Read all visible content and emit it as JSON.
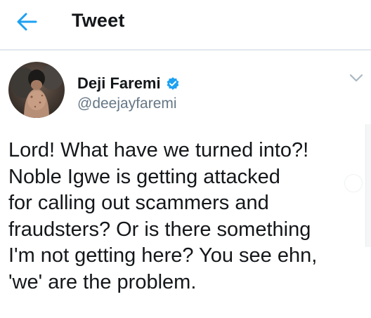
{
  "header": {
    "title": "Tweet",
    "back_icon": "arrow-left-icon",
    "accent_color": "#1da1f2"
  },
  "tweet": {
    "author": {
      "name": "Deji Faremi",
      "handle": "@deejayfaremi",
      "verified": true,
      "verified_icon": "verified-badge-icon",
      "verified_color": "#1da1f2"
    },
    "menu_icon": "chevron-down-icon",
    "text_lines": [
      "Lord! What have we turned into?!",
      "Noble Igwe is getting attacked",
      "for calling out scammers and",
      "fraudsters? Or is there something",
      "I'm not getting here? You see ehn,",
      "'we' are the problem."
    ]
  }
}
